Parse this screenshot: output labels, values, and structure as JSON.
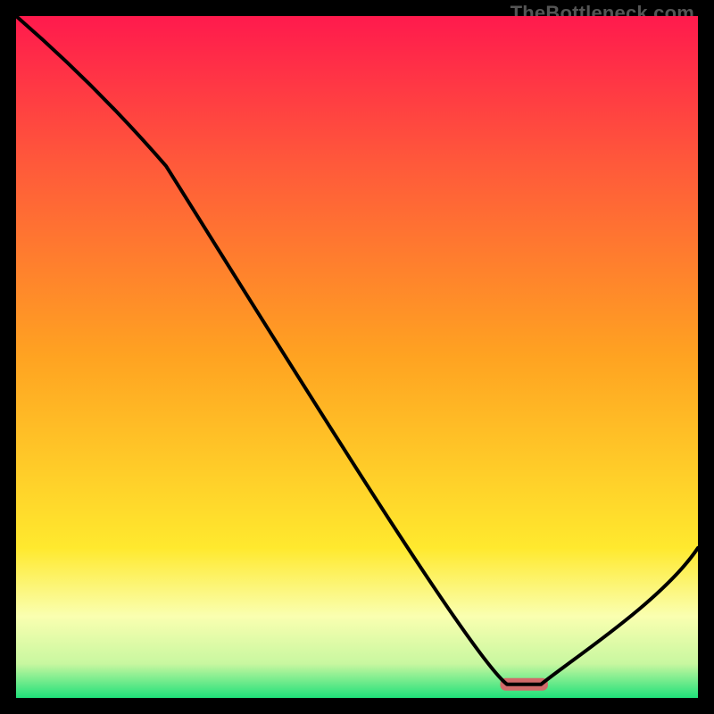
{
  "watermark": "TheBottleneck.com",
  "colors": {
    "top": "#ff1a4d",
    "mid_top": "#ff5a3a",
    "mid": "#ffa321",
    "mid_low": "#ffe92e",
    "low_green": "#1fe07a",
    "line": "#000000",
    "marker": "#d16a6a",
    "frame": "#000000"
  },
  "chart_data": {
    "type": "line",
    "title": "",
    "xlabel": "",
    "ylabel": "",
    "xlim": [
      0,
      100
    ],
    "ylim": [
      0,
      100
    ],
    "x": [
      0,
      22,
      72,
      77,
      100
    ],
    "values": [
      100,
      78,
      2,
      2,
      22
    ],
    "optimal_band": {
      "x_start": 71,
      "x_end": 78,
      "y": 2
    },
    "gradient_stops": [
      {
        "pos": 0,
        "color": "#ff1a4d"
      },
      {
        "pos": 22,
        "color": "#ff5a3a"
      },
      {
        "pos": 50,
        "color": "#ffa321"
      },
      {
        "pos": 78,
        "color": "#ffe92e"
      },
      {
        "pos": 88,
        "color": "#faffb0"
      },
      {
        "pos": 95,
        "color": "#c8f7a0"
      },
      {
        "pos": 100,
        "color": "#1fe07a"
      }
    ]
  }
}
